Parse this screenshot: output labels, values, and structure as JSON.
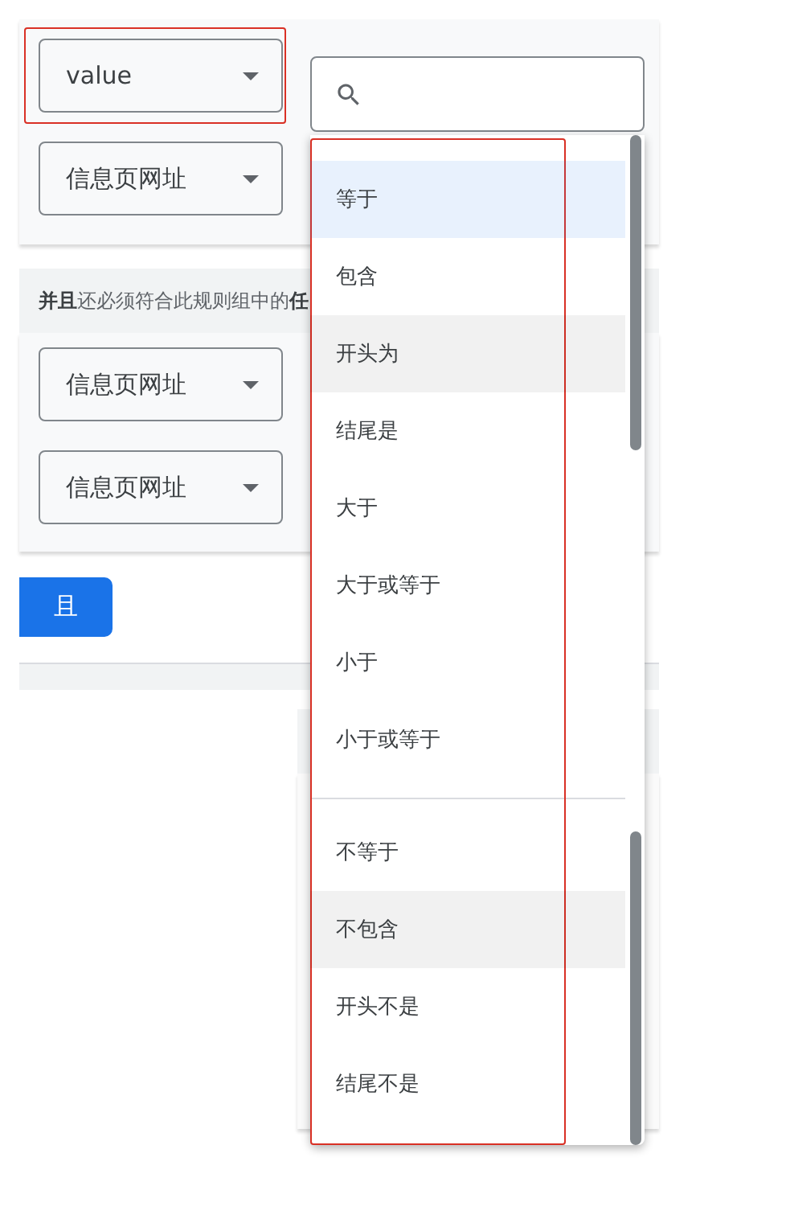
{
  "top_filters": [
    {
      "value": "value",
      "highlighted": true
    },
    {
      "value": "信息页网址",
      "highlighted": false
    }
  ],
  "rule_group_note": "**并且**还必须符合此规则组中的**任**",
  "group_filters": [
    {
      "value": "信息页网址",
      "highlighted": false
    },
    {
      "value": "信息页网址",
      "highlighted": false
    }
  ],
  "and_button": "且",
  "operator_menu": {
    "highlighted": true,
    "groups": [
      [
        {
          "label": "等于",
          "selected": true,
          "shaded": false
        },
        {
          "label": "包含",
          "selected": false,
          "shaded": false
        },
        {
          "label": "开头为",
          "selected": false,
          "shaded": true
        },
        {
          "label": "结尾是",
          "selected": false,
          "shaded": false
        },
        {
          "label": "大于",
          "selected": false,
          "shaded": false
        },
        {
          "label": "大于或等于",
          "selected": false,
          "shaded": false
        },
        {
          "label": "小于",
          "selected": false,
          "shaded": false
        },
        {
          "label": "小于或等于",
          "selected": false,
          "shaded": false
        }
      ],
      [
        {
          "label": "不等于",
          "selected": false,
          "shaded": false
        },
        {
          "label": "不包含",
          "selected": false,
          "shaded": true
        },
        {
          "label": "开头不是",
          "selected": false,
          "shaded": false
        },
        {
          "label": "结尾不是",
          "selected": false,
          "shaded": false
        }
      ]
    ]
  }
}
